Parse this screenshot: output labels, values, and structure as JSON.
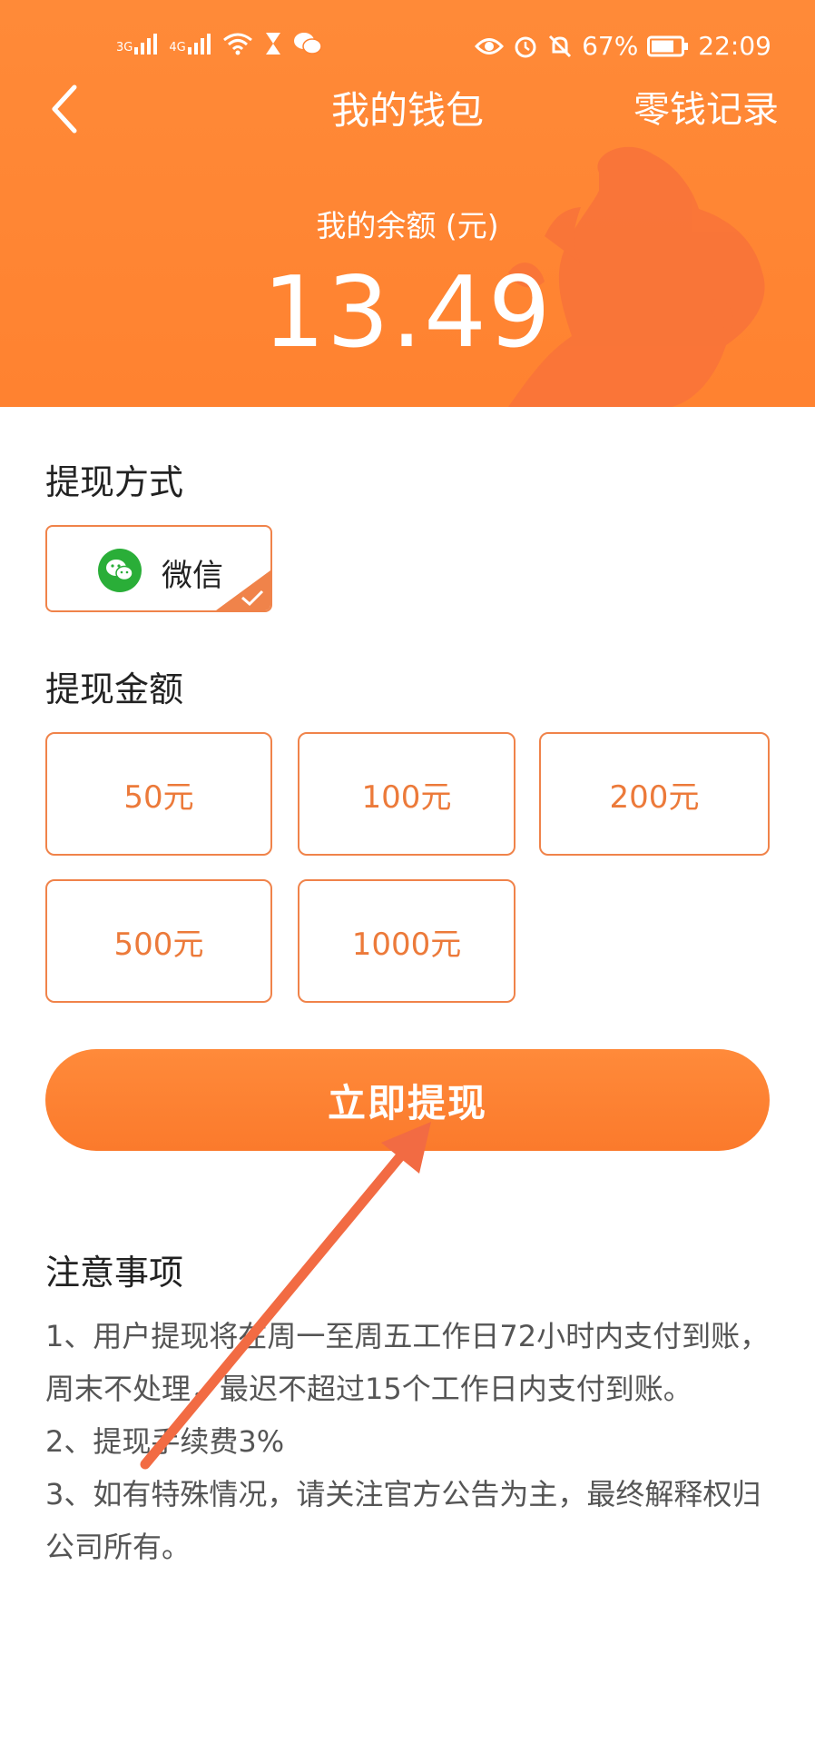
{
  "status_bar": {
    "net1": "3G",
    "net2": "4G",
    "battery": "67%",
    "time": "22:09"
  },
  "navbar": {
    "title": "我的钱包",
    "records_link": "零钱记录"
  },
  "balance": {
    "label": "我的余额 (元)",
    "value": "13.49"
  },
  "withdraw_method": {
    "title": "提现方式",
    "option_label": "微信"
  },
  "withdraw_amount": {
    "title": "提现金额",
    "options": [
      "50元",
      "100元",
      "200元",
      "500元",
      "1000元"
    ]
  },
  "submit_button": "立即提现",
  "notes": {
    "title": "注意事项",
    "items": [
      "1、用户提现将在周一至周五工作日72小时内支付到账，周末不处理，最迟不超过15个工作日内支付到账。",
      "2、提现手续费3%",
      "3、如有特殊情况，请关注官方公告为主，最终解释权归公司所有。"
    ]
  },
  "colors": {
    "header": "#ff8230",
    "accent": "#f0834a",
    "annotation_arrow": "#f26b43"
  }
}
